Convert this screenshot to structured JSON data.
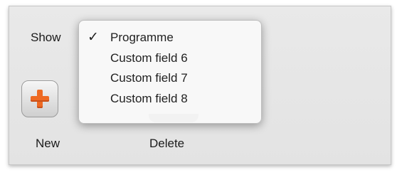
{
  "toolbar": {
    "show_label": "Show",
    "new_label": "New",
    "delete_label": "Delete",
    "accent_color": "#ee6a23"
  },
  "menu": {
    "items": [
      {
        "label": "Programme",
        "checked": true,
        "check_glyph": "✓"
      },
      {
        "label": "Custom field 6",
        "checked": false
      },
      {
        "label": "Custom field 7",
        "checked": false
      },
      {
        "label": "Custom field 8",
        "checked": false
      }
    ]
  },
  "icons": {
    "new": "plus-icon",
    "check": "checkmark-icon"
  }
}
